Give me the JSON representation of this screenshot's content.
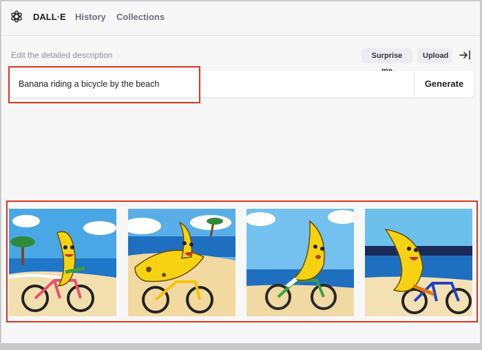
{
  "nav": {
    "logo_icon": "openai-logo-icon",
    "brand": "DALL·E",
    "history": "History",
    "collections": "Collections"
  },
  "toolbar": {
    "description_label": "Edit the detailed description",
    "surprise_label": "Surprise me",
    "upload_label": "Upload",
    "collapse_icon": "collapse-right-icon"
  },
  "prompt": {
    "value": "Banana riding a bicycle by the beach",
    "generate_label": "Generate"
  },
  "images": [
    {
      "name": "banana-bicycle-image-1"
    },
    {
      "name": "banana-bicycle-image-2"
    },
    {
      "name": "banana-bicycle-image-3"
    },
    {
      "name": "banana-bicycle-image-4"
    }
  ],
  "colors": {
    "highlight": "#e0321c",
    "banana": "#f5d313",
    "sky": "#5aaee8",
    "sea": "#1f6fc1",
    "sand": "#f2dfae"
  }
}
